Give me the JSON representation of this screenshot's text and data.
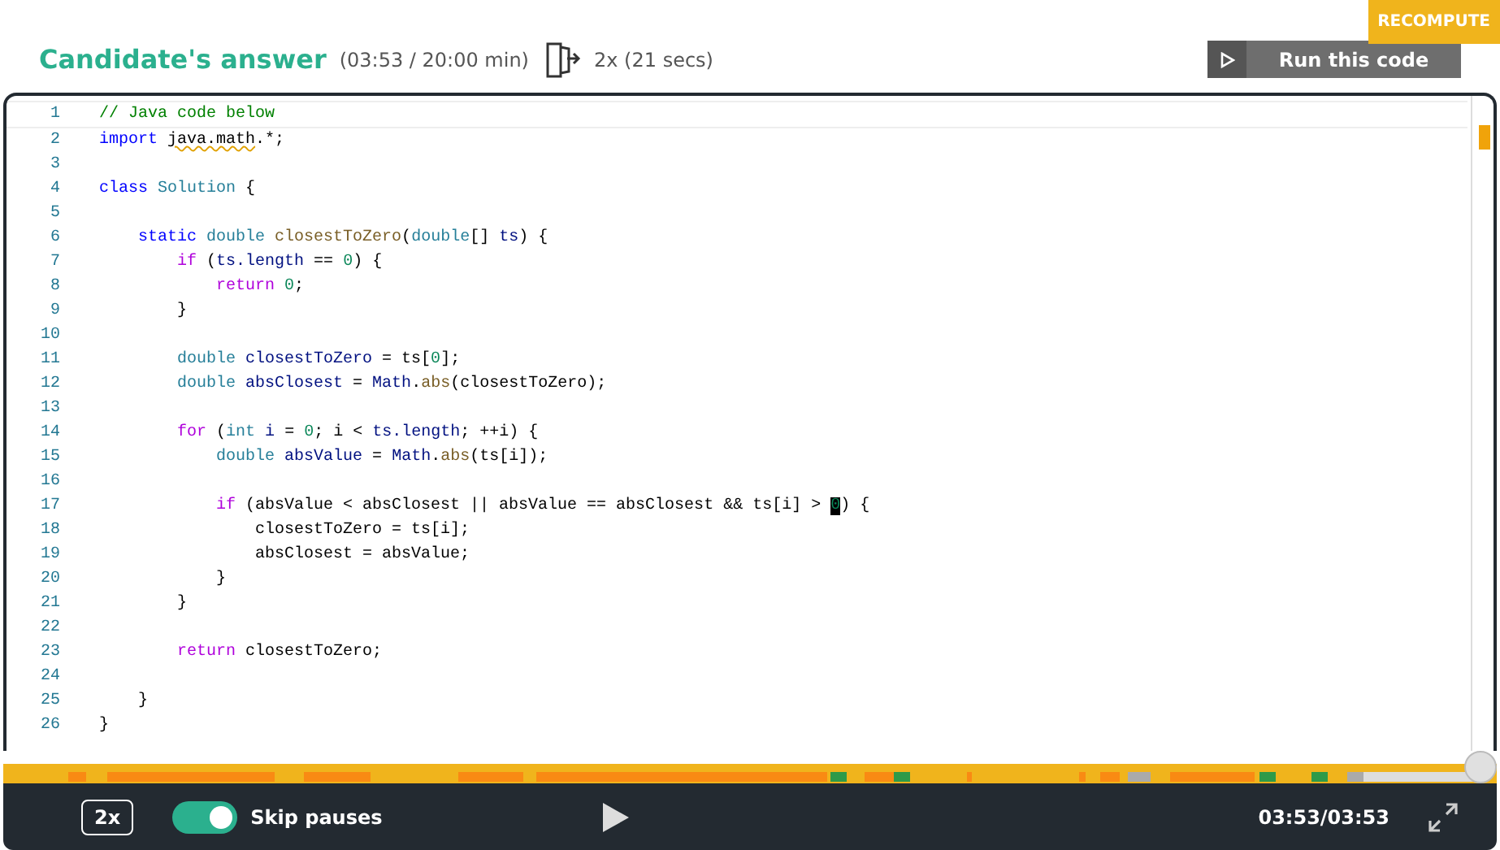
{
  "header": {
    "title": "Candidate's answer",
    "duration": "(03:53 / 20:00 min)",
    "speed_info": "2x (21 secs)",
    "recompute": "RECOMPUTE",
    "run_button": "Run this code"
  },
  "code_lines": [
    {
      "number": "1",
      "tokens": [
        {
          "kind": "comment",
          "text": "// Java code below"
        }
      ]
    },
    {
      "number": "2",
      "tokens": [
        {
          "kind": "keyword",
          "text": "import "
        },
        {
          "kind": "warning",
          "text": "java.math"
        },
        {
          "kind": "plain",
          "text": ".*;"
        }
      ]
    },
    {
      "number": "3"
    },
    {
      "number": "4",
      "tokens": [
        {
          "kind": "keyword",
          "text": "class "
        },
        {
          "kind": "type",
          "text": "Solution"
        },
        {
          "kind": "plain",
          "text": " {"
        }
      ]
    },
    {
      "number": "5"
    },
    {
      "number": "6",
      "tokens": [
        {
          "kind": "keyword",
          "text": "    static "
        },
        {
          "kind": "type",
          "text": "double "
        },
        {
          "kind": "function",
          "text": "closestToZero"
        },
        {
          "kind": "plain",
          "text": "("
        },
        {
          "kind": "type",
          "text": "double"
        },
        {
          "kind": "plain",
          "text": "[] "
        },
        {
          "kind": "variable",
          "text": "ts"
        },
        {
          "kind": "plain",
          "text": ") {"
        }
      ]
    },
    {
      "number": "7",
      "tokens": [
        {
          "kind": "control",
          "text": "        if"
        },
        {
          "kind": "plain",
          "text": " ("
        },
        {
          "kind": "variable",
          "text": "ts.length"
        },
        {
          "kind": "plain",
          "text": " == "
        },
        {
          "kind": "number",
          "text": "0"
        },
        {
          "kind": "plain",
          "text": ") {"
        }
      ]
    },
    {
      "number": "8",
      "tokens": [
        {
          "kind": "control",
          "text": "            return "
        },
        {
          "kind": "number",
          "text": "0"
        },
        {
          "kind": "plain",
          "text": ";"
        }
      ]
    },
    {
      "number": "9",
      "tokens": [
        {
          "kind": "plain",
          "text": "        }"
        }
      ]
    },
    {
      "number": "10"
    },
    {
      "number": "11",
      "tokens": [
        {
          "kind": "type",
          "text": "        double "
        },
        {
          "kind": "variable",
          "text": "closestToZero"
        },
        {
          "kind": "plain",
          "text": " = ts["
        },
        {
          "kind": "number",
          "text": "0"
        },
        {
          "kind": "plain",
          "text": "];"
        }
      ]
    },
    {
      "number": "12",
      "tokens": [
        {
          "kind": "type",
          "text": "        double "
        },
        {
          "kind": "variable",
          "text": "absClosest"
        },
        {
          "kind": "plain",
          "text": " = "
        },
        {
          "kind": "variable",
          "text": "Math"
        },
        {
          "kind": "plain",
          "text": "."
        },
        {
          "kind": "function",
          "text": "abs"
        },
        {
          "kind": "plain",
          "text": "(closestToZero);"
        }
      ]
    },
    {
      "number": "13"
    },
    {
      "number": "14",
      "tokens": [
        {
          "kind": "control",
          "text": "        for"
        },
        {
          "kind": "plain",
          "text": " ("
        },
        {
          "kind": "type",
          "text": "int "
        },
        {
          "kind": "variable",
          "text": "i"
        },
        {
          "kind": "plain",
          "text": " = "
        },
        {
          "kind": "number",
          "text": "0"
        },
        {
          "kind": "plain",
          "text": "; i < "
        },
        {
          "kind": "variable",
          "text": "ts.length"
        },
        {
          "kind": "plain",
          "text": "; ++i) {"
        }
      ]
    },
    {
      "number": "15",
      "tokens": [
        {
          "kind": "type",
          "text": "            double "
        },
        {
          "kind": "variable",
          "text": "absValue"
        },
        {
          "kind": "plain",
          "text": " = "
        },
        {
          "kind": "variable",
          "text": "Math"
        },
        {
          "kind": "plain",
          "text": "."
        },
        {
          "kind": "function",
          "text": "abs"
        },
        {
          "kind": "plain",
          "text": "(ts[i]);"
        }
      ]
    },
    {
      "number": "16"
    },
    {
      "number": "17",
      "tokens": [
        {
          "kind": "control",
          "text": "            if"
        },
        {
          "kind": "plain",
          "text": " (absValue < absClosest || absValue == absClosest && ts[i] > "
        },
        {
          "kind": "cursor",
          "text": "0"
        },
        {
          "kind": "plain",
          "text": ") {"
        }
      ]
    },
    {
      "number": "18",
      "tokens": [
        {
          "kind": "plain",
          "text": "                closestToZero = ts[i];"
        }
      ]
    },
    {
      "number": "19",
      "tokens": [
        {
          "kind": "plain",
          "text": "                absClosest = absValue;"
        }
      ]
    },
    {
      "number": "20",
      "tokens": [
        {
          "kind": "plain",
          "text": "            }"
        }
      ]
    },
    {
      "number": "21",
      "tokens": [
        {
          "kind": "plain",
          "text": "        }"
        }
      ]
    },
    {
      "number": "22"
    },
    {
      "number": "23",
      "tokens": [
        {
          "kind": "control",
          "text": "        return"
        },
        {
          "kind": "plain",
          "text": " closestToZero;"
        }
      ]
    },
    {
      "number": "24"
    },
    {
      "number": "25",
      "tokens": [
        {
          "kind": "plain",
          "text": "    }"
        }
      ]
    },
    {
      "number": "26",
      "tokens": [
        {
          "kind": "plain",
          "text": "}"
        }
      ]
    }
  ],
  "player": {
    "level": 1,
    "speed": "2x",
    "skip_pauses": {
      "label": "Skip pauses",
      "on": true
    },
    "time": "03:53/03:53"
  }
}
